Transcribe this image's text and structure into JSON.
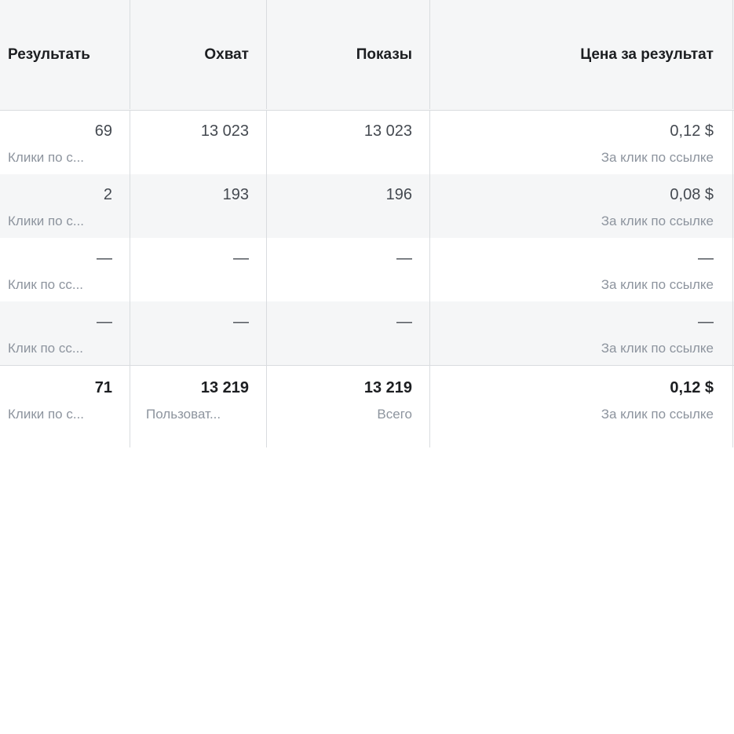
{
  "columns": [
    "Результать",
    "Охват",
    "Показы",
    "Цена за результат"
  ],
  "rows": [
    {
      "result": "69",
      "result_sub": "Клики по с...",
      "reach": "13 023",
      "reach_sub": "",
      "impressions": "13 023",
      "impressions_sub": "",
      "cost": "0,12 $",
      "cost_sub": "За клик по ссылке"
    },
    {
      "result": "2",
      "result_sub": "Клики по с...",
      "reach": "193",
      "reach_sub": "",
      "impressions": "196",
      "impressions_sub": "",
      "cost": "0,08 $",
      "cost_sub": "За клик по ссылке"
    },
    {
      "result": "—",
      "result_sub": "Клик по сс...",
      "reach": "—",
      "reach_sub": "",
      "impressions": "—",
      "impressions_sub": "",
      "cost": "—",
      "cost_sub": "За клик по ссылке"
    },
    {
      "result": "—",
      "result_sub": "Клик по сс...",
      "reach": "—",
      "reach_sub": "",
      "impressions": "—",
      "impressions_sub": "",
      "cost": "—",
      "cost_sub": "За клик по ссылке"
    }
  ],
  "total": {
    "result": "71",
    "result_sub": "Клики по с...",
    "reach": "13 219",
    "reach_sub": "Пользоват...",
    "impressions": "13 219",
    "impressions_sub": "Всего",
    "cost": "0,12 $",
    "cost_sub": "За клик по ссылке"
  }
}
